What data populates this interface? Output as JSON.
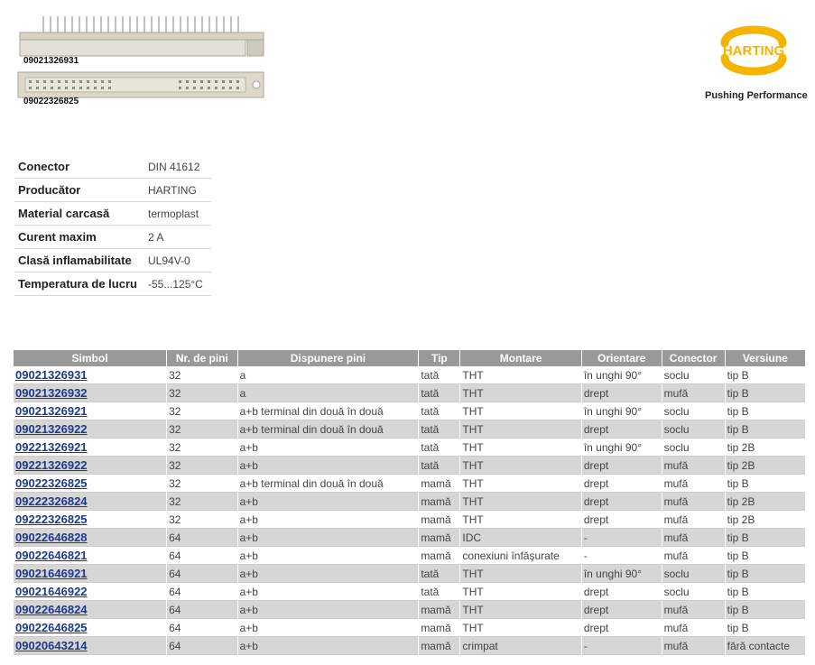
{
  "product_images": {
    "image1_code": "09021326931",
    "image2_code": "09022326825"
  },
  "brand": {
    "logo_text": "HARTING",
    "tagline": "Pushing Performance",
    "logo_color": "#f5b400"
  },
  "specs": [
    {
      "label": "Conector",
      "value": "DIN 41612"
    },
    {
      "label": "Producător",
      "value": "HARTING"
    },
    {
      "label": "Material carcasă",
      "value": "termoplast"
    },
    {
      "label": "Curent maxim",
      "value": "2 A"
    },
    {
      "label": "Clasă inflamabilitate",
      "value": "UL94V-0"
    },
    {
      "label": "Temperatura de lucru",
      "value": "-55...125°C"
    }
  ],
  "table": {
    "headers": [
      "Simbol",
      "Nr. de pini",
      "Dispunere pini",
      "Tip",
      "Montare",
      "Orientare",
      "Conector",
      "Versiune"
    ],
    "rows": [
      [
        "09021326931",
        "32",
        "a",
        "tată",
        "THT",
        "în unghi 90°",
        "soclu",
        "tip B"
      ],
      [
        "09021326932",
        "32",
        "a",
        "tată",
        "THT",
        "drept",
        "mufă",
        "tip B"
      ],
      [
        "09021326921",
        "32",
        "a+b terminal din două în două",
        "tată",
        "THT",
        "în unghi 90°",
        "soclu",
        "tip B"
      ],
      [
        "09021326922",
        "32",
        "a+b terminal din două în două",
        "tată",
        "THT",
        "drept",
        "soclu",
        "tip B"
      ],
      [
        "09221326921",
        "32",
        "a+b",
        "tată",
        "THT",
        "în unghi 90°",
        "soclu",
        "tip 2B"
      ],
      [
        "09221326922",
        "32",
        "a+b",
        "tată",
        "THT",
        "drept",
        "mufă",
        "tip 2B"
      ],
      [
        "09022326825",
        "32",
        "a+b terminal din două în două",
        "mamă",
        "THT",
        "drept",
        "mufă",
        "tip B"
      ],
      [
        "09222326824",
        "32",
        "a+b",
        "mamă",
        "THT",
        "drept",
        "mufă",
        "tip 2B"
      ],
      [
        "09222326825",
        "32",
        "a+b",
        "mamă",
        "THT",
        "drept",
        "mufă",
        "tip 2B"
      ],
      [
        "09022646828",
        "64",
        "a+b",
        "mamă",
        "IDC",
        "-",
        "mufă",
        "tip B"
      ],
      [
        "09022646821",
        "64",
        "a+b",
        "mamă",
        "conexiuni înfăşurate",
        "-",
        "mufă",
        "tip B"
      ],
      [
        "09021646921",
        "64",
        "a+b",
        "tată",
        "THT",
        "în unghi 90°",
        "soclu",
        "tip B"
      ],
      [
        "09021646922",
        "64",
        "a+b",
        "tată",
        "THT",
        "drept",
        "soclu",
        "tip B"
      ],
      [
        "09022646824",
        "64",
        "a+b",
        "mamă",
        "THT",
        "drept",
        "mufă",
        "tip B"
      ],
      [
        "09022646825",
        "64",
        "a+b",
        "mamă",
        "THT",
        "drept",
        "mufă",
        "tip B"
      ],
      [
        "09020643214",
        "64",
        "a+b",
        "mamă",
        "crimpat",
        "-",
        "mufă",
        "fără contacte"
      ]
    ]
  }
}
